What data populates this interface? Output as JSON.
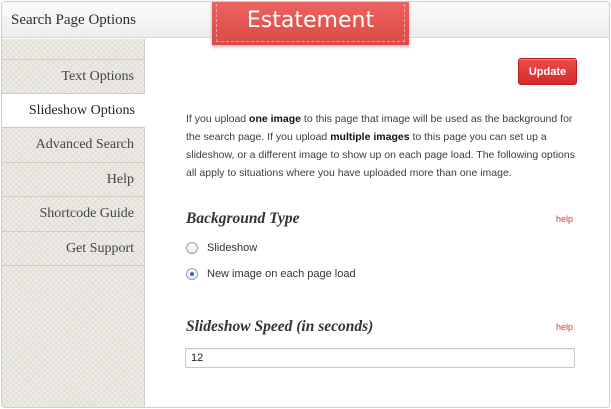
{
  "header": {
    "title": "Search Page Options",
    "brand": "Estatement"
  },
  "sidebar": {
    "items": [
      {
        "label": "Text Options",
        "active": false
      },
      {
        "label": "Slideshow Options",
        "active": true
      },
      {
        "label": "Advanced Search",
        "active": false
      },
      {
        "label": "Help",
        "active": false
      },
      {
        "label": "Shortcode Guide",
        "active": false
      },
      {
        "label": "Get Support",
        "active": false
      }
    ]
  },
  "main": {
    "update_label": "Update",
    "intro": {
      "part1": "If you upload ",
      "bold1": "one image",
      "part2": " to this page that image will be used as the background for the search page. If you upload ",
      "bold2": "multiple images",
      "part3": " to this page you can set up a slideshow, or a different image to show up on each page load. The following options all apply to situations where you have uploaded more than one image."
    },
    "background_type": {
      "title": "Background Type",
      "help": "help",
      "options": [
        {
          "label": "Slideshow",
          "checked": false
        },
        {
          "label": "New image on each page load",
          "checked": true
        }
      ]
    },
    "slideshow_speed": {
      "title": "Slideshow Speed (in seconds)",
      "help": "help",
      "value": "12"
    }
  },
  "colors": {
    "brand_red": "#e05350",
    "button_red": "#e03a3a",
    "help_link": "#d8372f",
    "radio_checked": "#2d6bc0"
  }
}
